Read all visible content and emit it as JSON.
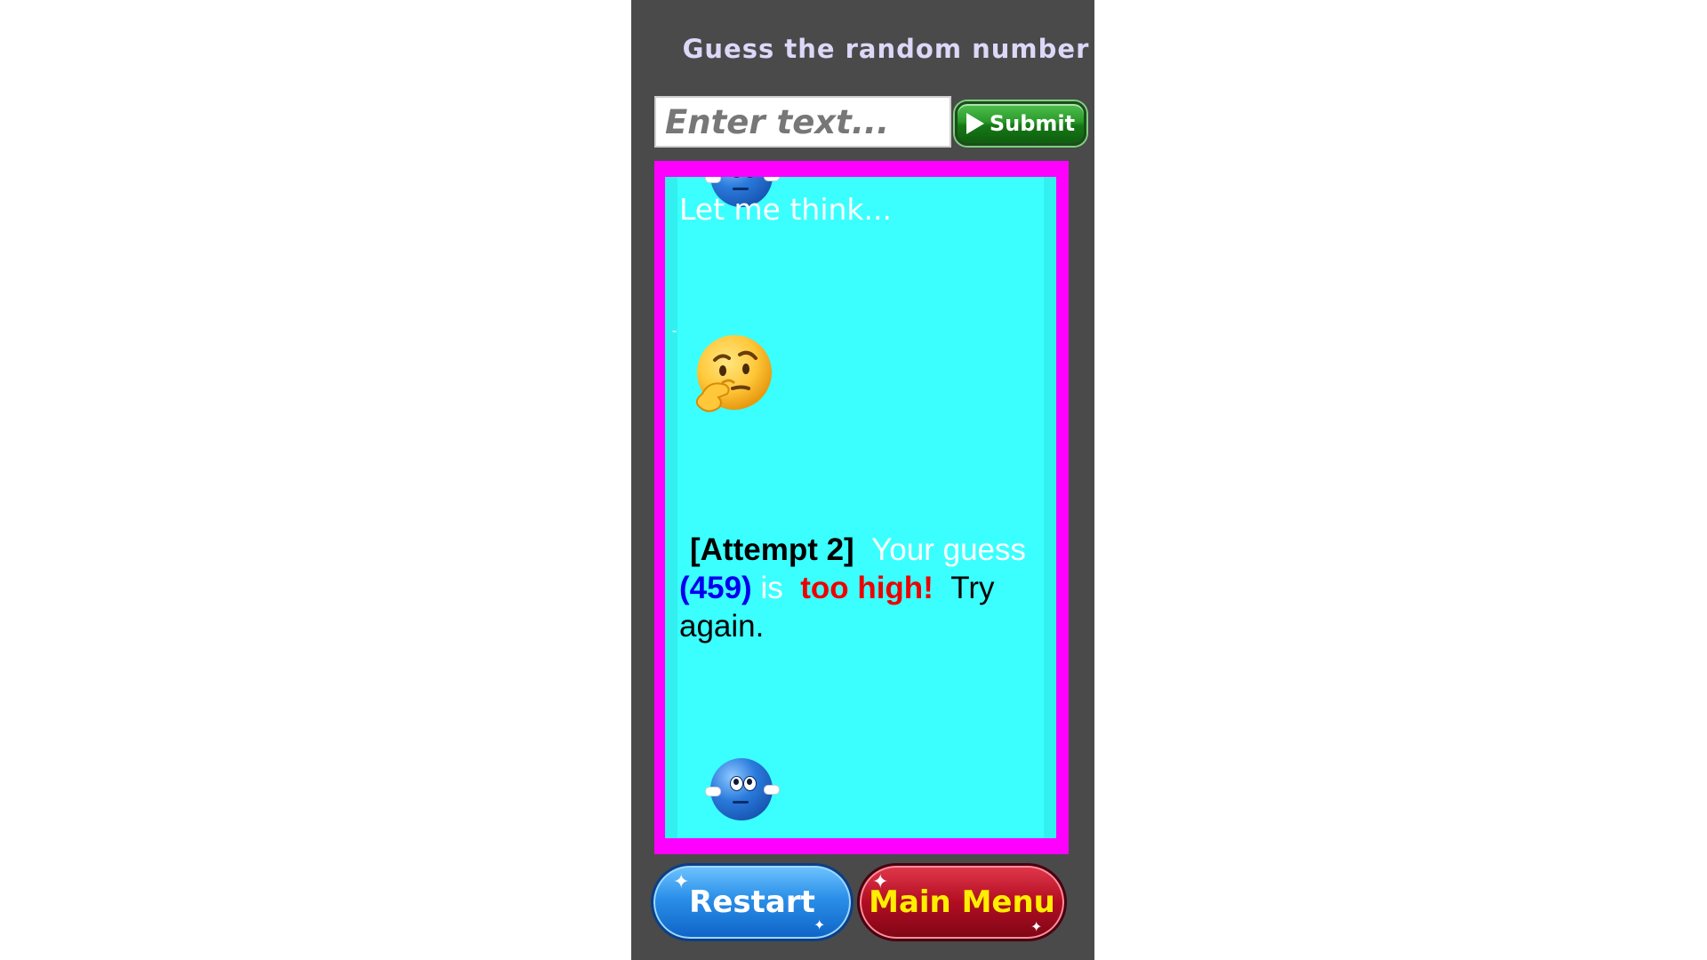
{
  "header": {
    "title": "Guess the random number"
  },
  "input": {
    "placeholder": "Enter text...",
    "value": ""
  },
  "submit": {
    "label": "Submit",
    "icon": "play-icon",
    "color": "#2a9a2a"
  },
  "board": {
    "border_color": "#ff00ff",
    "background_color": "#3bffff",
    "thinking_text": "Let me think...",
    "thinking_emoji": "thinking-face-emoji",
    "mascot": "blue-ball-mascot",
    "message": {
      "attempt": "[Attempt 2]",
      "part1": "Your guess",
      "guess": "(459)",
      "part2": "is",
      "verdict": "too high!",
      "part3": "Try again."
    }
  },
  "buttons": {
    "restart": "Restart",
    "main_menu": "Main Menu"
  }
}
